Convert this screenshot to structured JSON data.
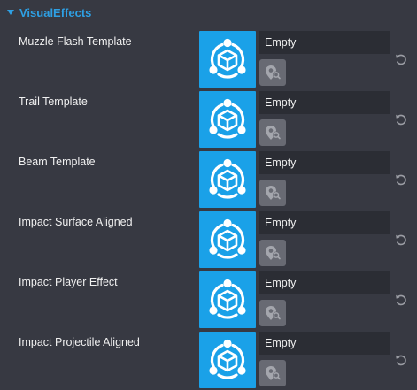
{
  "section": {
    "title": "VisualEffects",
    "expanded": true
  },
  "colors": {
    "accent": "#2ea0e4",
    "thumbnail": "#1aa1e8",
    "panel_bg": "#373942",
    "field_bg": "#2b2d34",
    "picker_bg": "#686a73"
  },
  "icons": {
    "thumbnail": "effect-template-icon",
    "picker": "pick-asset-icon",
    "reset": "reset-icon"
  },
  "properties": [
    {
      "label": "Muzzle Flash Template",
      "value": "Empty"
    },
    {
      "label": "Trail Template",
      "value": "Empty"
    },
    {
      "label": "Beam Template",
      "value": "Empty"
    },
    {
      "label": "Impact Surface Aligned",
      "value": "Empty"
    },
    {
      "label": "Impact Player Effect",
      "value": "Empty"
    },
    {
      "label": "Impact Projectile Aligned",
      "value": "Empty"
    }
  ]
}
